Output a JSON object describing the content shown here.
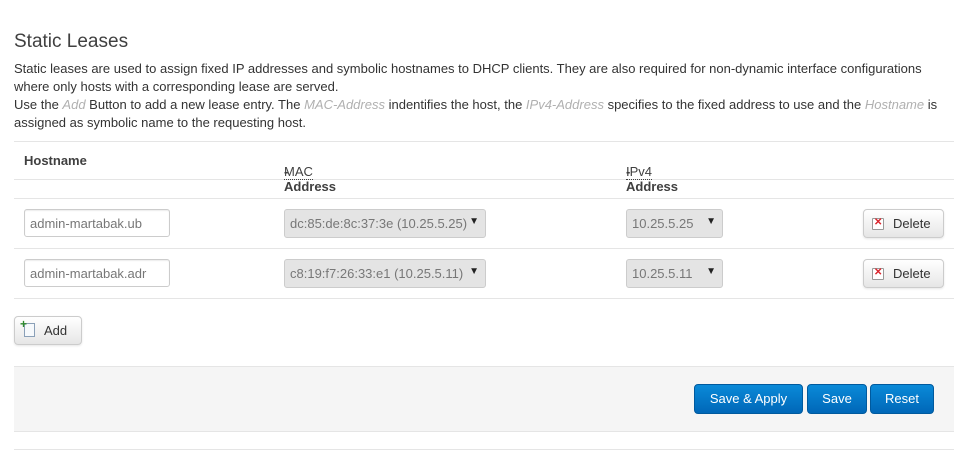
{
  "section": {
    "title": "Static Leases",
    "desc_line1": "Static leases are used to assign fixed IP addresses and symbolic hostnames to DHCP clients. They are also required for non-dynamic interface configurations where only hosts with a corresponding lease are served.",
    "desc_p1": "Use the ",
    "desc_em1": "Add",
    "desc_p2": " Button to add a new lease entry. The ",
    "desc_em2": "MAC-Address",
    "desc_p3": " indentifies the host, the ",
    "desc_em3": "IPv4-Address",
    "desc_p4": " specifies to the fixed address to use and the ",
    "desc_em4": "Hostname",
    "desc_p5": " is assigned as symbolic name to the requesting host."
  },
  "table": {
    "headers": {
      "hostname": "Hostname",
      "mac_abbr": "MAC",
      "mac_rest": "-Address",
      "ip_abbr": "IPv4",
      "ip_rest": "-Address"
    },
    "rows": [
      {
        "hostname": "admin-martabak.ub",
        "mac": "dc:85:de:8c:37:3e (10.25.5.25)",
        "ip": "10.25.5.25",
        "delete_label": "Delete"
      },
      {
        "hostname": "admin-martabak.adr",
        "mac": "c8:19:f7:26:33:e1 (10.25.5.11)",
        "ip": "10.25.5.11",
        "delete_label": "Delete"
      }
    ],
    "add_label": "Add"
  },
  "actions": {
    "save_apply": "Save & Apply",
    "save": "Save",
    "reset": "Reset"
  },
  "colors": {
    "primary": "#0a8ad8",
    "panel": "#f5f5f5",
    "delete_icon": "#d9232b"
  },
  "icons": [
    "delete-icon",
    "add-icon",
    "dropdown-caret-icon"
  ]
}
